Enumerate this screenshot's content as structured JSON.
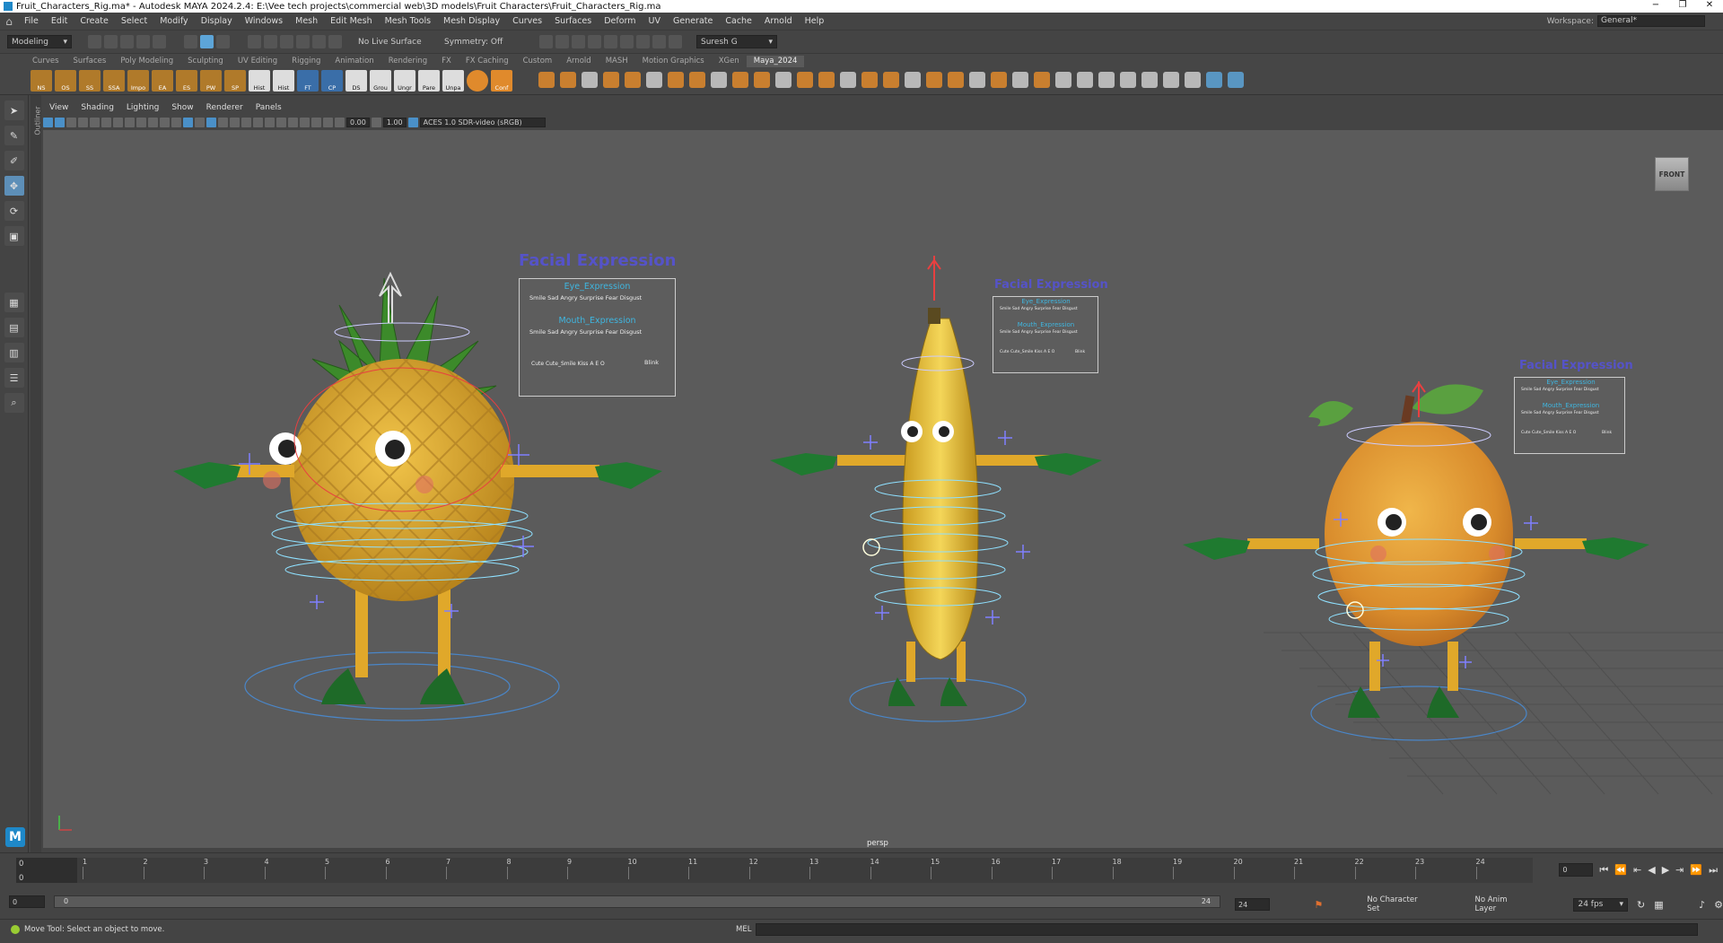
{
  "window": {
    "title": "Fruit_Characters_Rig.ma* - Autodesk MAYA 2024.2.4: E:\\Vee tech projects\\commercial web\\3D models\\Fruit Characters\\Fruit_Characters_Rig.ma",
    "controls": [
      "−",
      "❐",
      "✕"
    ]
  },
  "menus": [
    "File",
    "Edit",
    "Create",
    "Select",
    "Modify",
    "Display",
    "Windows",
    "Mesh",
    "Edit Mesh",
    "Mesh Tools",
    "Mesh Display",
    "Curves",
    "Surfaces",
    "Deform",
    "UV",
    "Generate",
    "Cache",
    "Arnold",
    "Help"
  ],
  "workspace": {
    "label": "Workspace:",
    "value": "General*"
  },
  "statusline": {
    "menuset": "Modeling",
    "live_surface": "No Live Surface",
    "symmetry": "Symmetry: Off",
    "user": "Suresh G"
  },
  "shelf_tabs": [
    {
      "label": "Curves",
      "active": false
    },
    {
      "label": "Surfaces",
      "active": false
    },
    {
      "label": "Poly Modeling",
      "active": false
    },
    {
      "label": "Sculpting",
      "active": false
    },
    {
      "label": "UV Editing",
      "active": false
    },
    {
      "label": "Rigging",
      "active": false
    },
    {
      "label": "Animation",
      "active": false
    },
    {
      "label": "Rendering",
      "active": false
    },
    {
      "label": "FX",
      "active": false
    },
    {
      "label": "FX Caching",
      "active": false
    },
    {
      "label": "Custom",
      "active": false
    },
    {
      "label": "Arnold",
      "active": false
    },
    {
      "label": "MASH",
      "active": false
    },
    {
      "label": "Motion Graphics",
      "active": false
    },
    {
      "label": "XGen",
      "active": false
    },
    {
      "label": "Maya_2024",
      "active": true
    }
  ],
  "shelf_buttons": [
    "NS",
    "OS",
    "SS",
    "SSA",
    "Impo",
    "EA",
    "ES",
    "PW",
    "SP",
    "Hist",
    "Hist",
    "FT",
    "CP",
    "DS",
    "Grou",
    "Ungr",
    "Pare",
    "Unpa",
    "",
    "Conf"
  ],
  "toolbox_icons": [
    "select-icon",
    "lasso-icon",
    "paint-icon",
    "move-icon",
    "rotate-icon",
    "scale-icon"
  ],
  "outliner_label": "Outliner",
  "panel_menus": [
    "View",
    "Shading",
    "Lighting",
    "Show",
    "Renderer",
    "Panels"
  ],
  "panel_toolbar": {
    "exposure": "0.00",
    "gamma": "1.00",
    "colorspace": "ACES 1.0 SDR-video (sRGB)"
  },
  "viewport": {
    "camera": "persp",
    "viewcube": "FRONT",
    "panels": [
      {
        "title": "Facial Expression",
        "eye": "Eye_Expression",
        "eye_labels": "Smile  Sad  Angry Surprise Fear Disgust",
        "mouth": "Mouth_Expression",
        "mouth_labels": "Smile  Sad  Angry Surprise Fear Disgust",
        "bottom_labels": "Cute Cute_Smile Kiss  A  E  O",
        "blink": "Blink"
      },
      {
        "title": "Facial Expression",
        "eye": "Eye_Expression",
        "eye_labels": "Smile Sad Angry Surprise Fear Disgust",
        "mouth": "Mouth_Expression",
        "mouth_labels": "Smile Sad Angry Surprise Fear Disgust",
        "bottom_labels": "Cute Cute_Smile Kiss A E O",
        "blink": "Blink"
      },
      {
        "title": "Facial Expression",
        "eye": "Eye_Expression",
        "eye_labels": "Smile Sad Angry Surprise Fear Disgust",
        "mouth": "Mouth_Expression",
        "mouth_labels": "Smile Sad Angry Surprise Fear Disgust",
        "bottom_labels": "Cute Cute_Smile Kiss A E O",
        "blink": "Blink"
      }
    ]
  },
  "timeline": {
    "current_frame": "0",
    "ticks": [
      "1",
      "2",
      "3",
      "4",
      "5",
      "6",
      "7",
      "8",
      "9",
      "10",
      "11",
      "12",
      "13",
      "14",
      "15",
      "16",
      "17",
      "18",
      "19",
      "20",
      "21",
      "22",
      "23",
      "24"
    ],
    "frame_field": "0"
  },
  "range": {
    "start": "0",
    "inner_start": "0",
    "inner_end": "24",
    "end": "24",
    "character_set": "No Character Set",
    "anim_layer": "No Anim Layer",
    "fps": "24 fps"
  },
  "command": {
    "help": "Move Tool: Select an object to move.",
    "lang": "MEL"
  },
  "colors": {
    "accent": "#5d8fb8",
    "maya_blue": "#1e88c8",
    "shelf_orange": "#e08a2c",
    "panel_title": "#5553c8",
    "panel_sub": "#3fb6e0"
  }
}
